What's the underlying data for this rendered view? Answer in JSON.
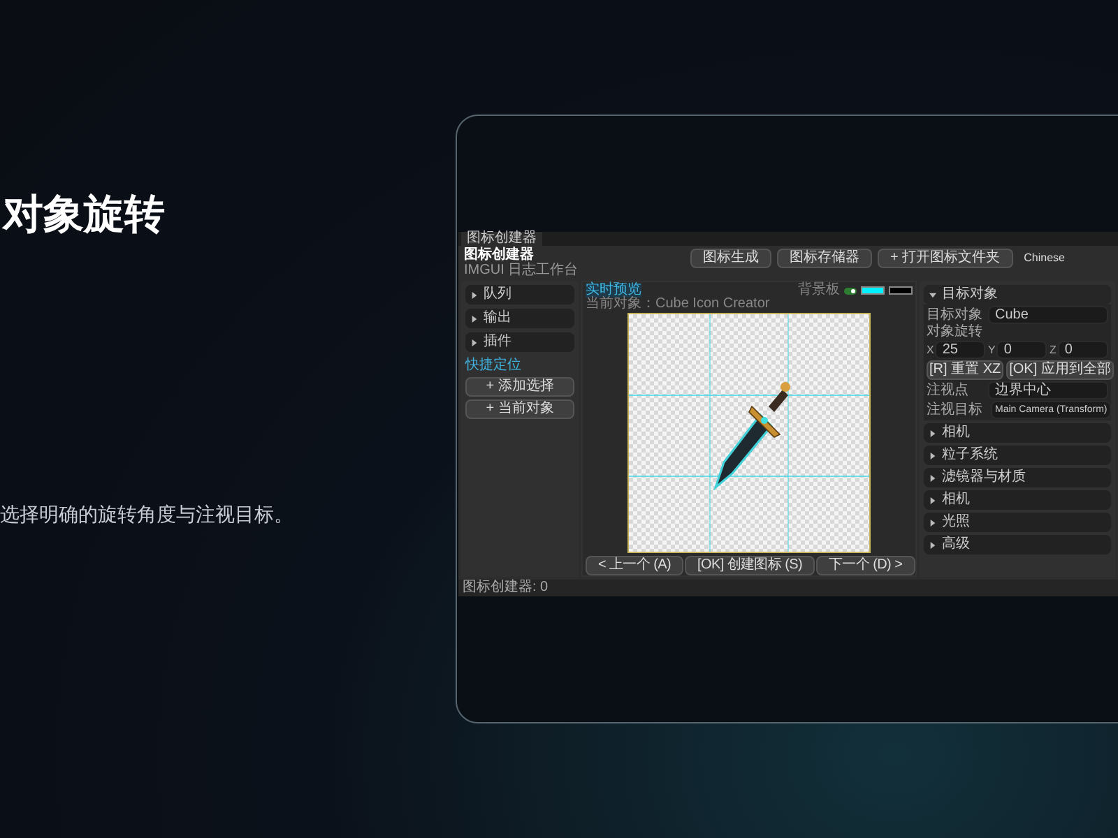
{
  "slide": {
    "title": "对象旋转",
    "subtitle": "选择明确的旋转角度与注视目标。"
  },
  "app": {
    "tab": "图标创建器",
    "title": "图标创建器",
    "subtitle": "IMGUI 日志工作台",
    "toolbar": {
      "buttons": [
        "图标生成",
        "图标存储器",
        "+ 打开图标文件夹"
      ],
      "language": "Chinese"
    },
    "left_panel": {
      "sections": [
        {
          "label": "队列",
          "expanded": false
        },
        {
          "label": "输出",
          "expanded": false
        },
        {
          "label": "插件",
          "expanded": false
        }
      ],
      "quick_label": "快捷定位",
      "buttons": [
        "+ 添加选择",
        "+ 当前对象"
      ]
    },
    "preview": {
      "title": "实时预览",
      "object_label": "当前对象：Cube Icon Creator",
      "background_label": "背景板",
      "background_on": true,
      "swatches": [
        {
          "color": "#00f0ff"
        },
        {
          "color": "#000000"
        }
      ],
      "nav_buttons": [
        "< 上一个 (A)",
        "[OK] 创建图标 (S)",
        "下一个 (D) >"
      ]
    },
    "inspector": {
      "sections": [
        {
          "label": "目标对象",
          "expanded": true
        },
        {
          "label": "相机",
          "expanded": false
        },
        {
          "label": "粒子系统",
          "expanded": false
        },
        {
          "label": "滤镜器与材质",
          "expanded": false
        },
        {
          "label": "相机",
          "expanded": false
        },
        {
          "label": "光照",
          "expanded": false
        },
        {
          "label": "高级",
          "expanded": false
        }
      ],
      "target_label": "目标对象",
      "target_value": "Cube",
      "rotation_label": "对象旋转",
      "rotation": [
        {
          "axis": "X",
          "value": "25"
        },
        {
          "axis": "Y",
          "value": "0"
        },
        {
          "axis": "Z",
          "value": "0"
        }
      ],
      "buttons": [
        "[R] 重置 XZ",
        "[OK] 应用到全部"
      ],
      "look_at_label": "注视点",
      "look_at_value": "边界中心",
      "look_target_label": "注视目标",
      "look_target_value": "Main Camera (Transform)"
    },
    "status": "图标创建器: 0"
  }
}
